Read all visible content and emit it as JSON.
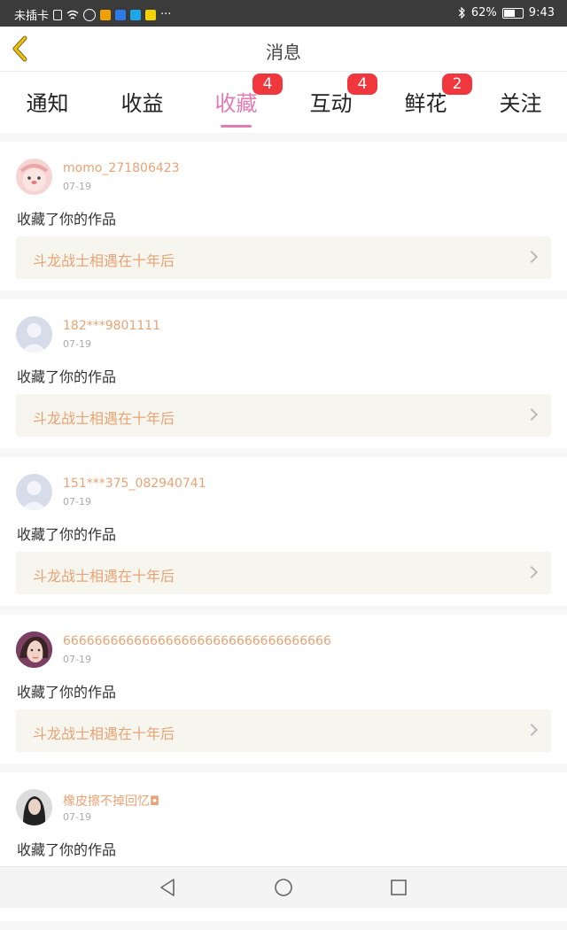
{
  "status_bar": {
    "carrier": "未插卡",
    "more": "···",
    "battery": "62%",
    "time": "9:43"
  },
  "header": {
    "title": "消息",
    "back_icon": "chevron-left-icon",
    "accent_color": "#f2c200"
  },
  "tabs": [
    {
      "label": "通知",
      "badge": ""
    },
    {
      "label": "收益",
      "badge": ""
    },
    {
      "label": "收藏",
      "badge": "4",
      "active": true
    },
    {
      "label": "互动",
      "badge": "4"
    },
    {
      "label": "鲜花",
      "badge": "2"
    },
    {
      "label": "关注",
      "badge": ""
    }
  ],
  "colors": {
    "active_tab": "#e27bb2",
    "badge": "#f0373e",
    "username": "#e8a375"
  },
  "items": [
    {
      "user": "momo_271806423",
      "date": "07-19",
      "action": "收藏了你的作品",
      "work": "斗龙战士相遇在十年后",
      "avatar": "pink-cartoon-avatar"
    },
    {
      "user": "182***9801111",
      "date": "07-19",
      "action": "收藏了你的作品",
      "work": "斗龙战士相遇在十年后",
      "avatar": "default-avatar"
    },
    {
      "user": "151***375_082940741",
      "date": "07-19",
      "action": "收藏了你的作品",
      "work": "斗龙战士相遇在十年后",
      "avatar": "default-avatar"
    },
    {
      "user": "6666666666666666666666666666666666",
      "date": "07-19",
      "action": "收藏了你的作品",
      "work": "斗龙战士相遇在十年后",
      "avatar": "photo-avatar"
    },
    {
      "user": "橡皮擦不掉回忆◘",
      "date": "07-19",
      "action": "收藏了你的作品",
      "work": "",
      "avatar": "photo-avatar-dark"
    }
  ],
  "nav": {
    "back": "back-triangle-icon",
    "home": "home-circle-icon",
    "recent": "recent-square-icon"
  }
}
